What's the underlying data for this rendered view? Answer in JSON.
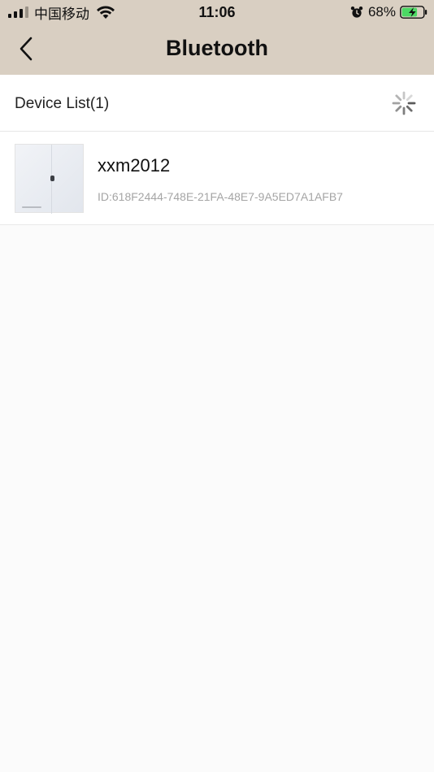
{
  "status_bar": {
    "carrier": "中国移动",
    "time": "11:06",
    "battery_percent": "68%",
    "battery_level": 0.68,
    "icons": [
      "signal-icon",
      "wifi-icon",
      "alarm-icon",
      "battery-charging-icon"
    ]
  },
  "nav": {
    "title": "Bluetooth",
    "back_icon": "chevron-left-icon"
  },
  "list": {
    "title": "Device List(1)",
    "spinner_icon": "loading-spinner-icon",
    "devices": [
      {
        "name": "xxm2012",
        "id": "ID:618F2444-748E-21FA-48E7-9A5ED7A1AFB7"
      }
    ]
  },
  "colors": {
    "header_bg": "#d9cfc2",
    "page_bg": "#fbfbfb",
    "battery_fill": "#4cd964",
    "secondary_text": "#a5a5a5"
  }
}
